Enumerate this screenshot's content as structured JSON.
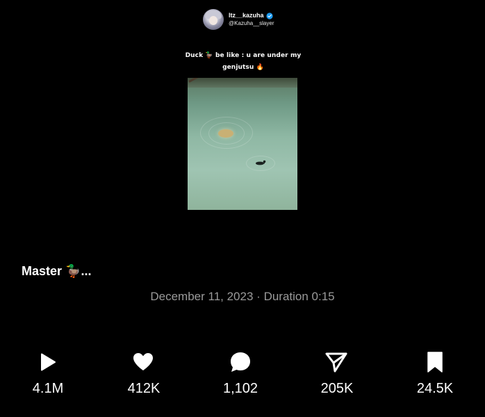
{
  "header": {
    "username": "ltz__kazuha",
    "handle": "@Kazuha__slayer"
  },
  "post": {
    "caption_line1": "Duck 🦆 be like : u are under my",
    "caption_line2": "genjutsu 🔥",
    "description": "Master 🦆...",
    "date": "December 11, 2023",
    "separator": "·",
    "duration_label": "Duration 0:15"
  },
  "actions": [
    {
      "name": "play",
      "count": "4.1M"
    },
    {
      "name": "like",
      "count": "412K"
    },
    {
      "name": "reply",
      "count": "1,102"
    },
    {
      "name": "share",
      "count": "205K"
    },
    {
      "name": "bookmark",
      "count": "24.5K"
    }
  ],
  "colors": {
    "background": "#000000",
    "verified": "#1d9bf0",
    "meta_text": "#9a9a9a"
  }
}
